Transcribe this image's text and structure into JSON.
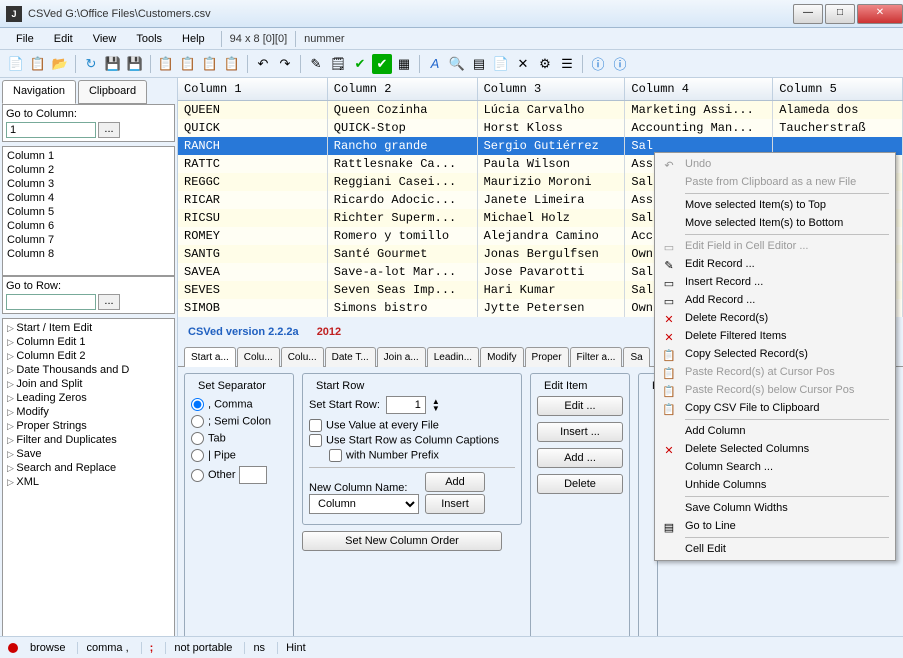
{
  "window": {
    "title": "CSVed G:\\Office Files\\Customers.csv"
  },
  "menu": {
    "file": "File",
    "edit": "Edit",
    "view": "View",
    "tools": "Tools",
    "help": "Help",
    "info1": "94 x 8 [0][0]",
    "info2": "nummer"
  },
  "leftTabs": {
    "nav": "Navigation",
    "clip": "Clipboard"
  },
  "gotoCol": {
    "label": "Go to Column:",
    "value": "1",
    "btn": "..."
  },
  "gotoRow": {
    "label": "Go to Row:",
    "value": "",
    "btn": "..."
  },
  "columns": [
    "Column 1",
    "Column 2",
    "Column 3",
    "Column 4",
    "Column 5",
    "Column 6",
    "Column 7",
    "Column 8"
  ],
  "tree": [
    "Start / Item Edit",
    "Column Edit 1",
    "Column Edit 2",
    "Date Thousands and D",
    "Join and Split",
    "Leading Zeros",
    "Modify",
    "Proper Strings",
    "Filter and Duplicates",
    "Save",
    "Search and Replace",
    "XML"
  ],
  "gridHeaders": [
    "Column 1",
    "Column 2",
    "Column 3",
    "Column 4",
    "Column 5"
  ],
  "gridRows": [
    {
      "c": [
        "QUEEN",
        "Queen Cozinha",
        "Lúcia Carvalho",
        "Marketing Assi...",
        "Alameda dos"
      ]
    },
    {
      "c": [
        "QUICK",
        "QUICK-Stop",
        "Horst Kloss",
        "Accounting Man...",
        "Taucherstraß"
      ]
    },
    {
      "c": [
        "RANCH",
        "Rancho grande",
        "Sergio Gutiérrez",
        "Sal",
        ""
      ],
      "sel": true
    },
    {
      "c": [
        "RATTC",
        "Rattlesnake Ca...",
        "Paula Wilson",
        "Ass",
        ""
      ]
    },
    {
      "c": [
        "REGGC",
        "Reggiani Casei...",
        "Maurizio Moroni",
        "Sal",
        ""
      ]
    },
    {
      "c": [
        "RICAR",
        "Ricardo Adocic...",
        "Janete Limeira",
        "Ass",
        ""
      ]
    },
    {
      "c": [
        "RICSU",
        "Richter Superm...",
        "Michael Holz",
        "Sal",
        ""
      ]
    },
    {
      "c": [
        "ROMEY",
        "Romero y tomillo",
        "Alejandra Camino",
        "Acc",
        ""
      ]
    },
    {
      "c": [
        "SANTG",
        "Santé Gourmet",
        "Jonas Bergulfsen",
        "Own",
        ""
      ]
    },
    {
      "c": [
        "SAVEA",
        "Save-a-lot Mar...",
        "Jose Pavarotti",
        "Sal",
        ""
      ]
    },
    {
      "c": [
        "SEVES",
        "Seven Seas Imp...",
        "Hari Kumar",
        "Sal",
        ""
      ]
    },
    {
      "c": [
        "SIMOB",
        "Simons bistro",
        "Jytte Petersen",
        "Own",
        ""
      ]
    }
  ],
  "version": {
    "app": "CSVed version 2.2.2a",
    "year": "2012"
  },
  "bottomTabs": [
    "Start a...",
    "Colu...",
    "Colu...",
    "Date T...",
    "Join a...",
    "Leadin...",
    "Modify",
    "Proper",
    "Filter a...",
    "Sa"
  ],
  "sep": {
    "legend": "Set Separator",
    "comma": ", Comma",
    "semi": "; Semi Colon",
    "tab": "Tab",
    "pipe": "| Pipe",
    "other": "Other",
    "otherVal": ""
  },
  "startRow": {
    "legend": "Start Row",
    "label": "Set Start Row:",
    "value": "1",
    "chk1": "Use Value at every File",
    "chk2": "Use Start Row as Column Captions",
    "chk3": "with Number Prefix",
    "newColLabel": "New Column Name:",
    "newColVal": "Column",
    "addBtn": "Add",
    "insertBtn": "Insert"
  },
  "editItem": {
    "legend": "Edit Item",
    "edit": "Edit ...",
    "insert": "Insert ...",
    "add": "Add ...",
    "delete": "Delete"
  },
  "helpLegend": "H",
  "newOrder": "Set New Column Order",
  "ctx": {
    "undo": "Undo",
    "pasteNew": "Paste from Clipboard as a new File",
    "moveTop": "Move selected Item(s) to Top",
    "moveBottom": "Move selected Item(s) to Bottom",
    "editCell": "Edit Field in Cell Editor ...",
    "editRec": "Edit Record ...",
    "insertRec": "Insert Record ...",
    "addRec": "Add Record ...",
    "delRec": "Delete Record(s)",
    "delFiltered": "Delete Filtered Items",
    "copySel": "Copy Selected Record(s)",
    "pasteAt": "Paste Record(s) at Cursor Pos",
    "pasteBelow": "Paste Record(s) below Cursor Pos",
    "copyCsv": "Copy CSV File to Clipboard",
    "addCol": "Add Column",
    "delCols": "Delete Selected Columns",
    "colSearch": "Column Search ...",
    "unhide": "Unhide Columns",
    "saveWidths": "Save Column Widths",
    "gotoLine": "Go to Line",
    "cellEdit": "Cell Edit"
  },
  "status": {
    "browse": "browse",
    "comma": "comma ,",
    "semi": ";",
    "portable": "not portable",
    "ns": "ns",
    "hint": "Hint"
  }
}
